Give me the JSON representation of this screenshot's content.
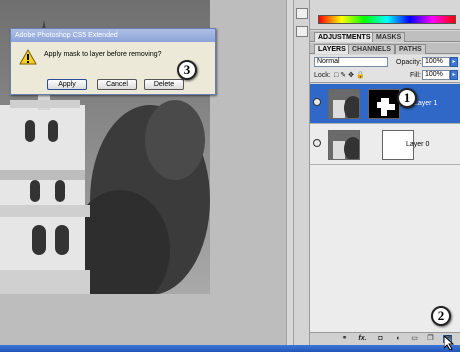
{
  "dialog": {
    "title": "Adobe Photoshop CS5 Extended",
    "message": "Apply mask to layer before removing?",
    "buttons": {
      "apply": "Apply",
      "cancel": "Cancel",
      "delete": "Delete"
    },
    "icon": "warning-icon"
  },
  "panel_tabs_top": [
    "ADJUSTMENTS",
    "MASKS"
  ],
  "panel_tabs_layers": [
    "LAYERS",
    "CHANNELS",
    "PATHS"
  ],
  "layers_controls": {
    "blend_mode": "Normal",
    "opacity_label": "Opacity:",
    "opacity_value": "100%",
    "lock_label": "Lock:",
    "fill_label": "Fill:",
    "fill_value": "100%"
  },
  "layers": [
    {
      "name": "Layer 1",
      "selected": true,
      "has_mask": true
    },
    {
      "name": "Layer 0",
      "selected": false,
      "has_mask": true
    }
  ],
  "footer_icons": [
    "link-icon",
    "fx-icon",
    "mask-icon",
    "adjustment-icon",
    "folder-icon",
    "new-layer-icon",
    "trash-icon"
  ],
  "footer_labels": {
    "fx": "fx."
  },
  "callouts": [
    "1",
    "2",
    "3"
  ],
  "colors": {
    "selected_layer": "#2f68c6",
    "dialog_title": "#8ca4d8",
    "taskbar": "#2354b8"
  }
}
